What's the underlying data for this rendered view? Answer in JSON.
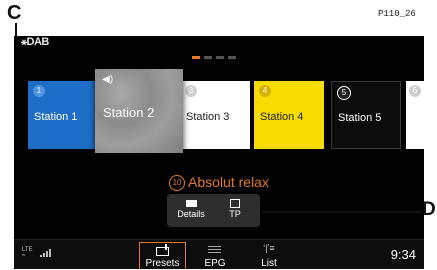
{
  "figure": {
    "callout_c": "C",
    "callout_d": "D",
    "code": "P110_26"
  },
  "header": {
    "logo": "DAB"
  },
  "carousel": {
    "stations": [
      {
        "number": "1",
        "name": "Station 1",
        "color": "#1e6ec8"
      },
      {
        "number": "",
        "name": "Station 2",
        "color": "#8f8f8f",
        "playing": true,
        "icon": "speaker-icon"
      },
      {
        "number": "3",
        "name": "Station 3",
        "color": "#ffffff"
      },
      {
        "number": "4",
        "name": "Station 4",
        "color": "#f6dc00"
      },
      {
        "number": "5",
        "name": "Station 5",
        "color": "#0b0b0b"
      },
      {
        "number": "6",
        "name": "",
        "color": "#ffffff"
      }
    ],
    "page_indicator": {
      "pages": 4,
      "active": 1,
      "accent": "#e07a2a"
    }
  },
  "now_playing": {
    "preset_number": "10",
    "station_name": "Absolut relax",
    "color": "#e07a2a"
  },
  "actions": {
    "details_label": "Details",
    "tp_label": "TP"
  },
  "status": {
    "network": "LTE",
    "time": "9:34"
  },
  "nav": {
    "presets_label": "Presets",
    "epg_label": "EPG",
    "list_label": "List",
    "active": "Presets"
  }
}
